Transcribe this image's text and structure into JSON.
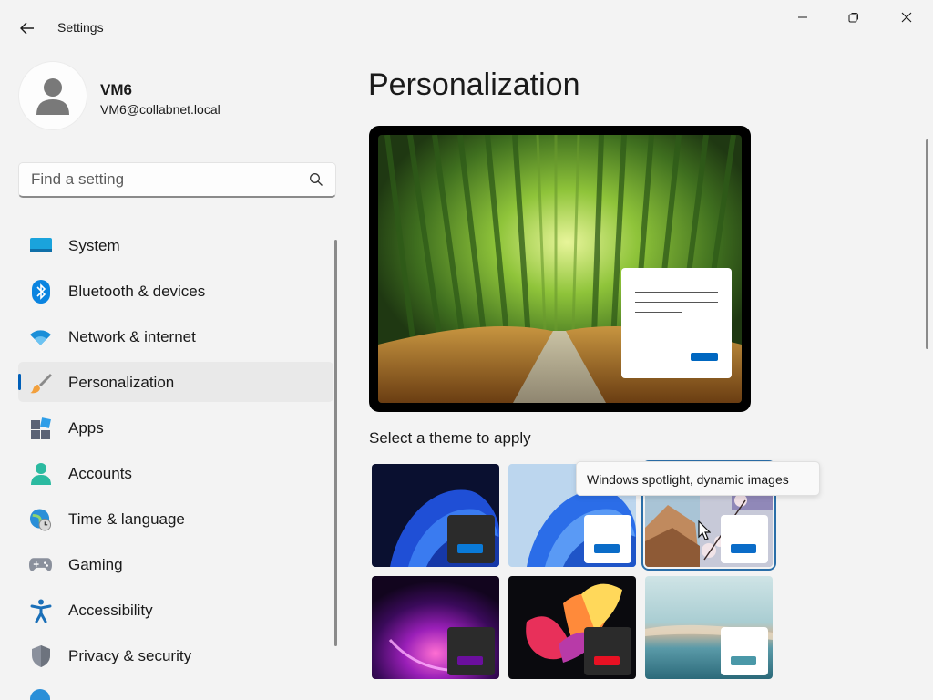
{
  "window": {
    "title": "Settings",
    "icons": {
      "back": "back-arrow-icon",
      "minimize": "minimize-icon",
      "maximize": "restore-icon",
      "close": "close-icon"
    }
  },
  "profile": {
    "name": "VM6",
    "email": "VM6@collabnet.local",
    "avatar_icon": "user-avatar-icon"
  },
  "search": {
    "placeholder": "Find a setting",
    "value": "",
    "icon": "search-icon"
  },
  "nav": {
    "items": [
      {
        "label": "System",
        "icon": "system-icon",
        "active": false
      },
      {
        "label": "Bluetooth & devices",
        "icon": "bluetooth-icon",
        "active": false
      },
      {
        "label": "Network & internet",
        "icon": "wifi-icon",
        "active": false
      },
      {
        "label": "Personalization",
        "icon": "paintbrush-icon",
        "active": true
      },
      {
        "label": "Apps",
        "icon": "apps-icon",
        "active": false
      },
      {
        "label": "Accounts",
        "icon": "accounts-icon",
        "active": false
      },
      {
        "label": "Time & language",
        "icon": "globe-clock-icon",
        "active": false
      },
      {
        "label": "Gaming",
        "icon": "gamepad-icon",
        "active": false
      },
      {
        "label": "Accessibility",
        "icon": "accessibility-icon",
        "active": false
      },
      {
        "label": "Privacy & security",
        "icon": "shield-icon",
        "active": false
      }
    ]
  },
  "main": {
    "title": "Personalization",
    "section_label": "Select a theme to apply",
    "tooltip": "Windows spotlight, dynamic images",
    "themes": [
      {
        "style": "windows-dark-bloom",
        "selected": false,
        "accent": "#0067c0"
      },
      {
        "style": "windows-light-bloom",
        "selected": false,
        "accent": "#0067c0"
      },
      {
        "style": "windows-spotlight",
        "selected": true,
        "accent": "#0067c0"
      },
      {
        "style": "glow",
        "selected": false,
        "accent": "#6b0f9e"
      },
      {
        "style": "captured-motion",
        "selected": false,
        "accent": "#e81123"
      },
      {
        "style": "flow",
        "selected": false,
        "accent": "#4a98a8"
      }
    ]
  },
  "colors": {
    "accent": "#005fb8",
    "background": "#f3f3f3",
    "active_nav": "#e9e9e9"
  }
}
